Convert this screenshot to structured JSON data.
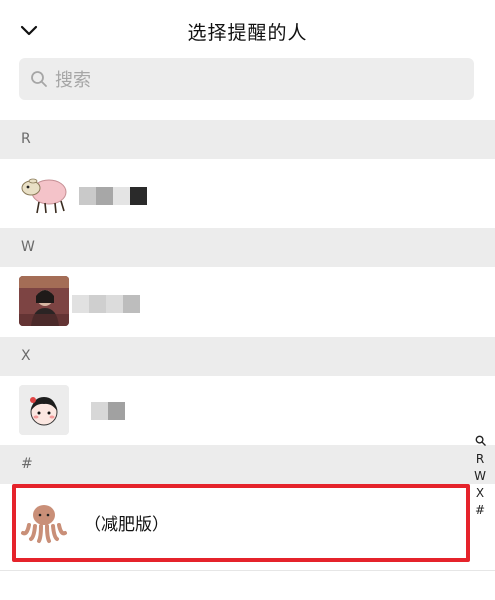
{
  "header": {
    "title": "选择提醒的人"
  },
  "search": {
    "placeholder": "搜索"
  },
  "sections": [
    {
      "letter": "R"
    },
    {
      "letter": "W"
    },
    {
      "letter": "X"
    },
    {
      "letter": "#"
    }
  ],
  "contacts": [
    {
      "section": "R",
      "avatar": "sheep-avatar",
      "name": ""
    },
    {
      "section": "W",
      "avatar": "photo-avatar",
      "name": ""
    },
    {
      "section": "X",
      "avatar": "cartoon-girl-avatar",
      "name": ""
    },
    {
      "section": "#",
      "avatar": "octopus-toy-avatar",
      "name": "（减肥版）"
    }
  ],
  "index_bar": {
    "items": [
      "R",
      "W",
      "X",
      "#"
    ]
  },
  "colors": {
    "highlight": "#e5232b",
    "section_bg": "#ececec",
    "search_bg": "#ededed"
  }
}
